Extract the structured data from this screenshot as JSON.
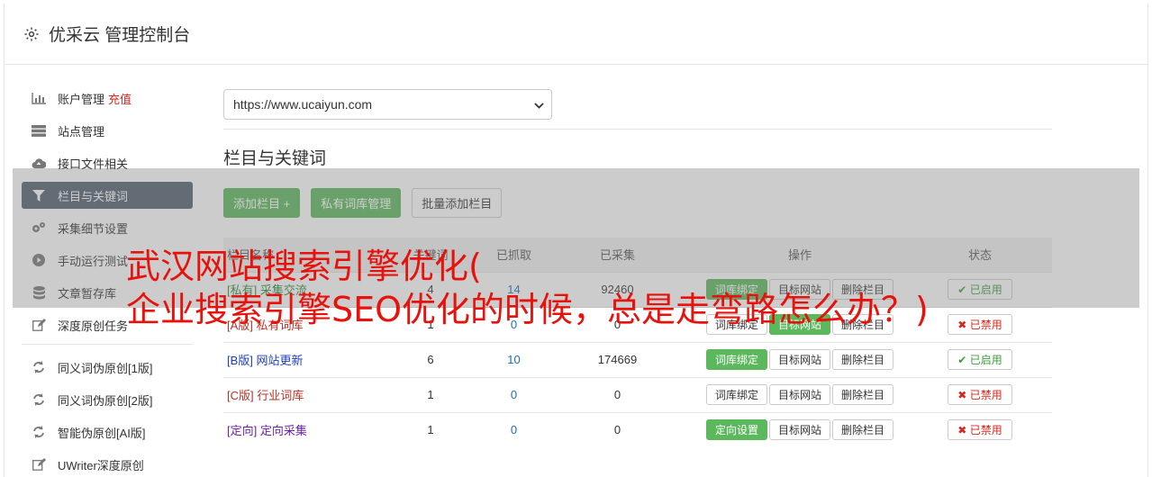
{
  "header": {
    "title": "优采云 管理控制台",
    "icon": "gear-icon"
  },
  "sidebar": {
    "account": {
      "label": "账户管理",
      "recharge": "充值",
      "icon": "bar-chart-icon"
    },
    "items": [
      {
        "label": "站点管理",
        "icon": "server-icon"
      },
      {
        "label": "接口文件相关",
        "icon": "cloud-upload-icon"
      },
      {
        "label": "栏目与关键词",
        "icon": "filter-icon",
        "active": true
      },
      {
        "label": "采集细节设置",
        "icon": "gears-icon"
      },
      {
        "label": "手动运行测试",
        "icon": "play-circle-icon"
      },
      {
        "label": "文章暂存库",
        "icon": "database-icon"
      },
      {
        "label": "深度原创任务",
        "icon": "edit-icon"
      }
    ],
    "items2": [
      {
        "label": "同义词伪原创[1版]",
        "icon": "refresh-icon"
      },
      {
        "label": "同义词伪原创[2版]",
        "icon": "refresh-icon"
      },
      {
        "label": "智能伪原创[AI版]",
        "icon": "refresh-icon"
      },
      {
        "label": "UWriter深度原创",
        "icon": "edit-icon"
      }
    ]
  },
  "main": {
    "site_select": "https://www.ucaiyun.com",
    "section_title": "栏目与关键词",
    "buttons": {
      "add": "添加栏目 +",
      "private": "私有词库管理",
      "batch": "批量添加栏目"
    },
    "table": {
      "headers": [
        "栏目名称",
        "关键词",
        "已抓取",
        "已采集",
        "操作",
        "状态"
      ],
      "rows": [
        {
          "tag": "[私有]",
          "name": "采集交流",
          "kw": "4",
          "fetched": "14",
          "collected": "92460",
          "op1": "词库绑定",
          "op2": "目标网站",
          "op3": "删除栏目",
          "status": "已启用"
        },
        {
          "tag": "[A版]",
          "name": "私有词库",
          "kw": "1",
          "fetched": "0",
          "collected": "0",
          "op1": "词库绑定",
          "op2": "目标网站",
          "op3": "删除栏目",
          "status": "已禁用"
        },
        {
          "tag": "[B版]",
          "name": "网站更新",
          "kw": "6",
          "fetched": "10",
          "collected": "174669",
          "op1": "词库绑定",
          "op2": "目标网站",
          "op3": "删除栏目",
          "status": "已启用"
        },
        {
          "tag": "[C版]",
          "name": "行业词库",
          "kw": "1",
          "fetched": "0",
          "collected": "0",
          "op1": "词库绑定",
          "op2": "目标网站",
          "op3": "删除栏目",
          "status": "已禁用"
        },
        {
          "tag": "[定向]",
          "name": "定向采集",
          "kw": "1",
          "fetched": "0",
          "collected": "0",
          "op1": "定向设置",
          "op2": "目标网站",
          "op3": "删除栏目",
          "status": "已禁用"
        }
      ]
    }
  },
  "overlay": {
    "line1": "武汉网站搜索引擎优化(",
    "line2": "企业搜索引擎SEO优化的时候，总是走弯路怎么办？)"
  },
  "colors": {
    "accent_green": "#5cb85c",
    "sidebar_active": "#51606d",
    "headline_red": "#e8110b"
  }
}
